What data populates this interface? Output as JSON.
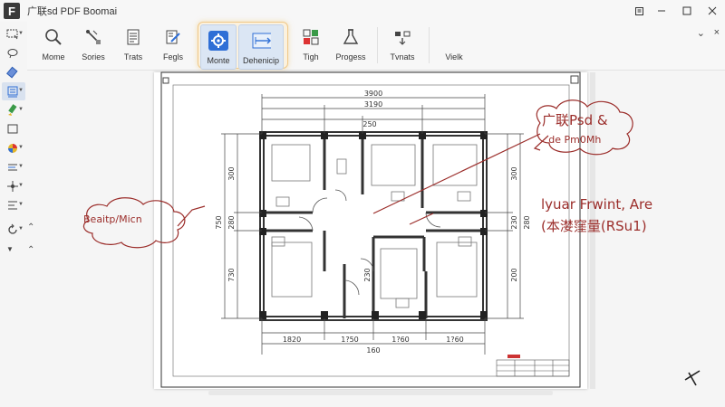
{
  "window": {
    "logo_letter": "F",
    "title": "广联sd PDF Boomai",
    "controls": [
      "restore",
      "minimize",
      "maximize",
      "close"
    ]
  },
  "ribbon": {
    "tools": [
      {
        "name": "mome",
        "label": "Mome",
        "icon": "magnifier-icon"
      },
      {
        "name": "sories",
        "label": "Sories",
        "icon": "pen-tool-icon"
      },
      {
        "name": "trats",
        "label": "Trats",
        "icon": "document-icon"
      },
      {
        "name": "fegls",
        "label": "Fegls",
        "icon": "edit-icon"
      },
      {
        "name": "monte",
        "label": "Monte",
        "icon": "gear-icon",
        "selected": true
      },
      {
        "name": "dehenicip",
        "label": "Dehenicip",
        "icon": "measure-icon",
        "selected": true
      },
      {
        "name": "tigh",
        "label": "Tigh",
        "icon": "grid-icon"
      },
      {
        "name": "progess",
        "label": "Progess",
        "icon": "flask-icon"
      },
      {
        "name": "tvnats",
        "label": "Tvnats",
        "icon": "transfer-icon"
      },
      {
        "name": "vielk",
        "label": "Vielk",
        "icon": "view-icon"
      }
    ],
    "collapse_glyph": "⌄",
    "close_glyph": "×"
  },
  "left_tools": [
    {
      "name": "select",
      "icon": "select-rect-icon"
    },
    {
      "name": "lasso",
      "icon": "lasso-icon"
    },
    {
      "name": "eraser",
      "icon": "eraser-icon"
    },
    {
      "name": "stamp",
      "icon": "stamp-icon",
      "active": true
    },
    {
      "name": "highlight",
      "icon": "highlighter-icon"
    },
    {
      "name": "crop",
      "icon": "crop-icon"
    },
    {
      "name": "color",
      "icon": "color-icon"
    },
    {
      "name": "text",
      "icon": "text-icon"
    },
    {
      "name": "snap",
      "icon": "snap-icon"
    },
    {
      "name": "align",
      "icon": "align-icon"
    },
    {
      "name": "rotate",
      "icon": "rotate-icon"
    }
  ],
  "drawing": {
    "dimensions_top": [
      "3900",
      "3190",
      "250"
    ],
    "dimensions_bottom": [
      "1820",
      "1?50",
      "1?60",
      "1?60",
      "160"
    ],
    "dimensions_left": [
      "300",
      "750",
      "280",
      "730"
    ],
    "dimensions_right": [
      "300",
      "230",
      "280",
      "200"
    ],
    "inner_dim": "230"
  },
  "annotations": {
    "cloud_top_right": [
      "广联Psd &",
      "de Pm0Mh"
    ],
    "cloud_left": "Beaitp/Micn",
    "note_right": [
      "lyuar Frwint, Are",
      "(本漤窪量(RSu1)"
    ]
  },
  "colors": {
    "accent": "#2f6fd6",
    "ink": "#9b2d2a",
    "selection_glow": "#f0c98a"
  }
}
